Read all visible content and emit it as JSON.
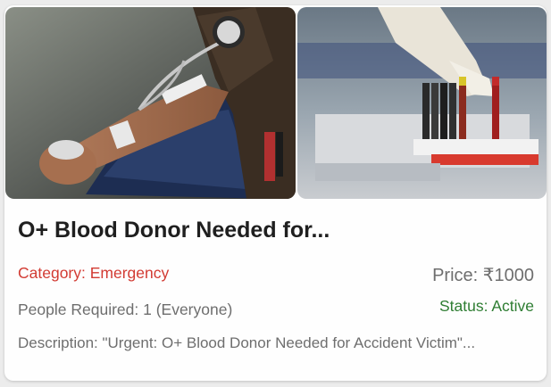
{
  "card": {
    "images": [
      {
        "icon": "blood-donation-photo"
      },
      {
        "icon": "blood-sample-tubes-photo"
      }
    ],
    "title": "O+ Blood Donor Needed for...",
    "category": "Category: Emergency",
    "price": "Price: ₹1000",
    "people_required": "People Required: 1 (Everyone)",
    "status": "Status: Active",
    "description": "Description: \"Urgent: O+ Blood Donor Needed for Accident Victim\"..."
  },
  "colors": {
    "category": "#d23b33",
    "status": "#2e7d32",
    "muted_text": "#6e6e6e",
    "title": "#1f1f1f"
  }
}
